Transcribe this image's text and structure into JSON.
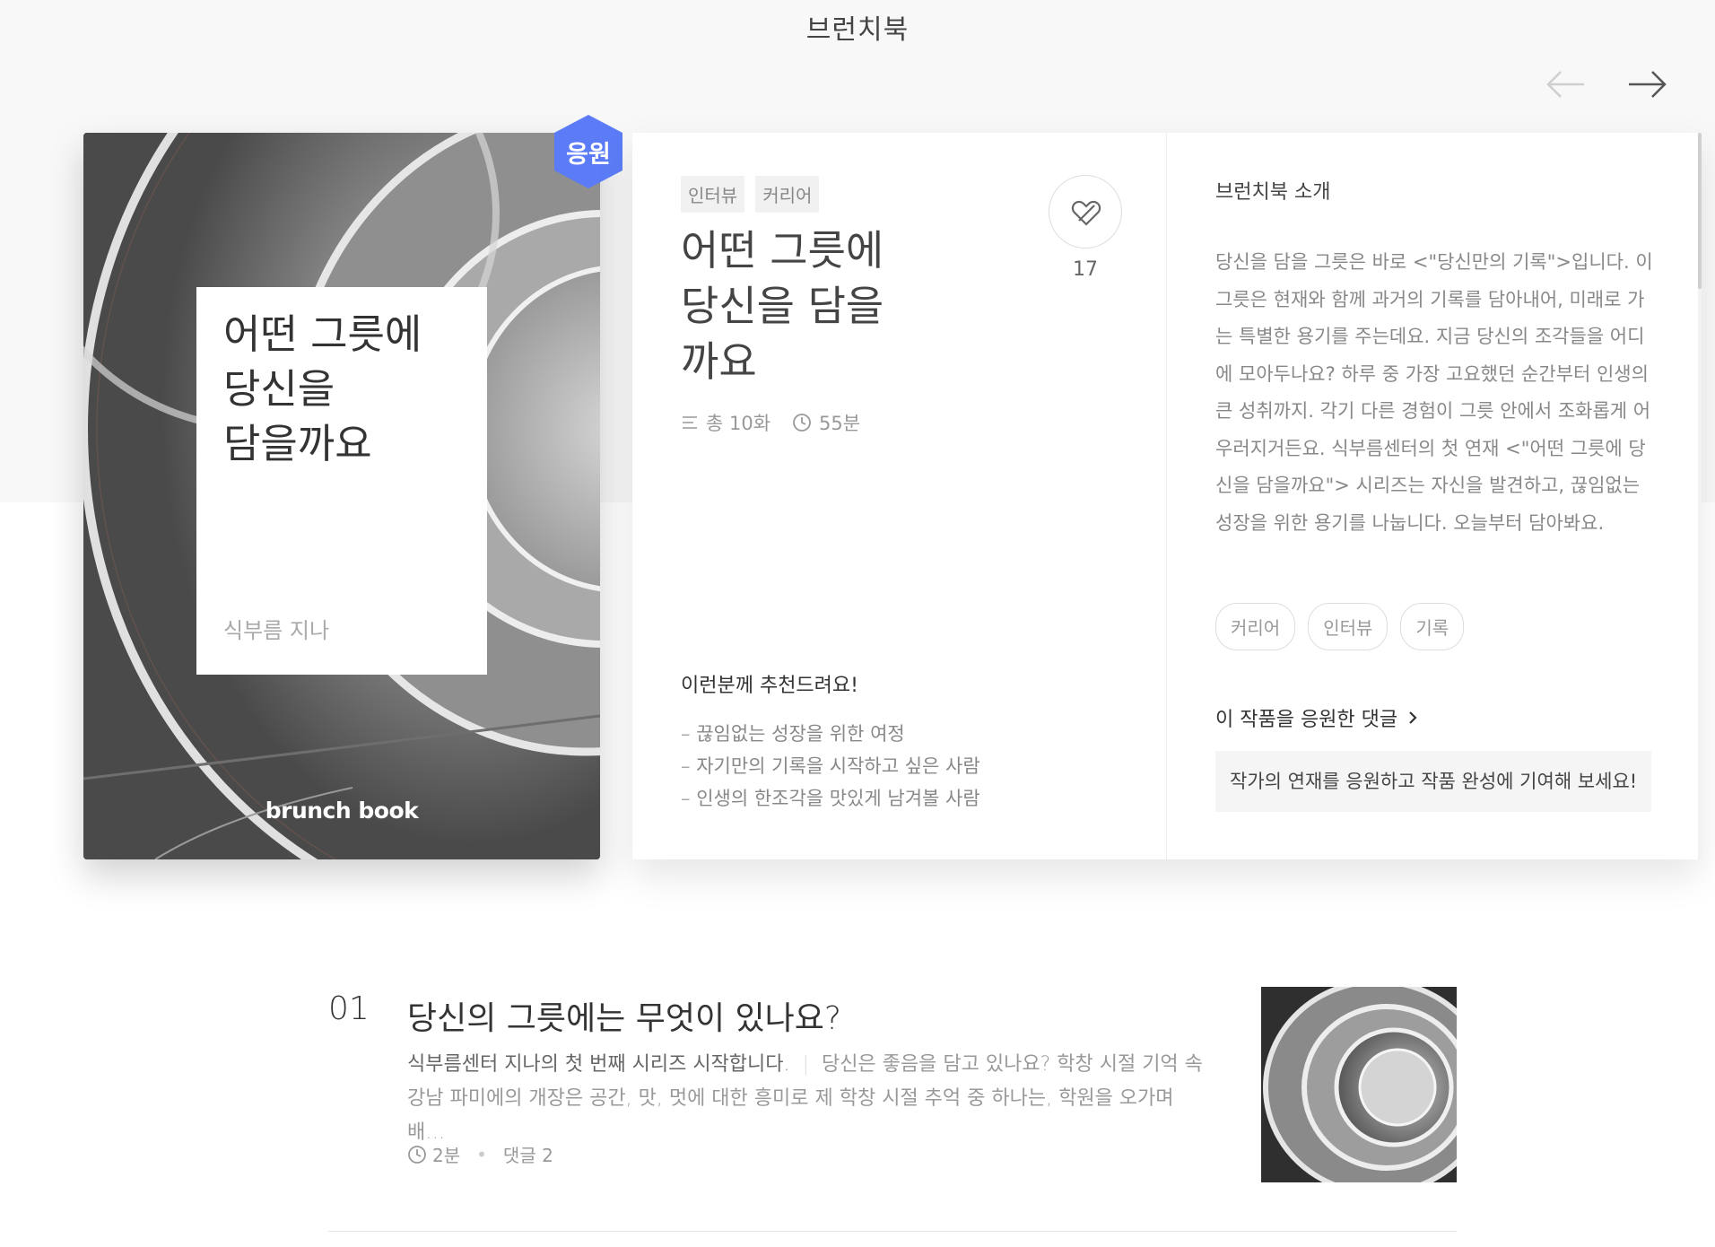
{
  "header": {
    "title": "브런치북"
  },
  "book": {
    "title": "어떤 그릇에\n당신을 담을\n까요",
    "cover_title": "어떤 그릇에\n당신을\n담을까요",
    "author": "식부름 지나",
    "brand": "brunch book",
    "badge": "응원",
    "chips": [
      "인터뷰",
      "커리어"
    ],
    "like_count": "17",
    "episodes": "총 10화",
    "duration": "55분"
  },
  "recommend": {
    "title": "이런분께 추천드려요!",
    "items": [
      "끊임없는 성장을 위한 여정",
      "자기만의 기록을 시작하고 싶은 사람",
      "인생의 한조각을 맛있게 남겨볼 사람"
    ]
  },
  "intro": {
    "label": "브런치북 소개",
    "text": "당신을 담을 그릇은 바로 <\"당신만의 기록\">입니다. 이 그릇은 현재와 함께 과거의 기록를 담아내어, 미래로 가는 특별한 용기를 주는데요. 지금 당신의 조각들을 어디에 모아두나요? 하루 중 가장 고요했던 순간부터 인생의 큰 성취까지. 각기 다른 경험이 그릇 안에서 조화롭게 어우러지거든요. 식부름센터의 첫 연재 <\"어떤 그릇에 당신을 담을까요\"> 시리즈는 자신을 발견하고, 끊임없는 성장을 위한 용기를 나눕니다. 오늘부터 담아봐요.",
    "keywords": [
      "커리어",
      "인터뷰",
      "기록"
    ],
    "comments_link": "이 작품을 응원한 댓글",
    "support_text": "작가의 연재를 응원하고 작품 완성에 기여해 보세요!"
  },
  "articles": [
    {
      "number": "01",
      "title": "당신의 그릇에는 무엇이 있나요?",
      "lead": "식부름센터 지나의 첫 번째 시리즈 시작합니다.",
      "excerpt": "당신은 좋음을 담고 있나요? 학창 시절 기억 속 강남 파미에의 개장은 공간, 맛, 멋에 대한 흥미로 제 학창 시절 추억 중 하나는, 학원을 오가며 배…",
      "read_time": "2분",
      "comments": "댓글 2"
    }
  ],
  "colors": {
    "badge": "#5b7cf6",
    "background": "#f8f8f8"
  }
}
